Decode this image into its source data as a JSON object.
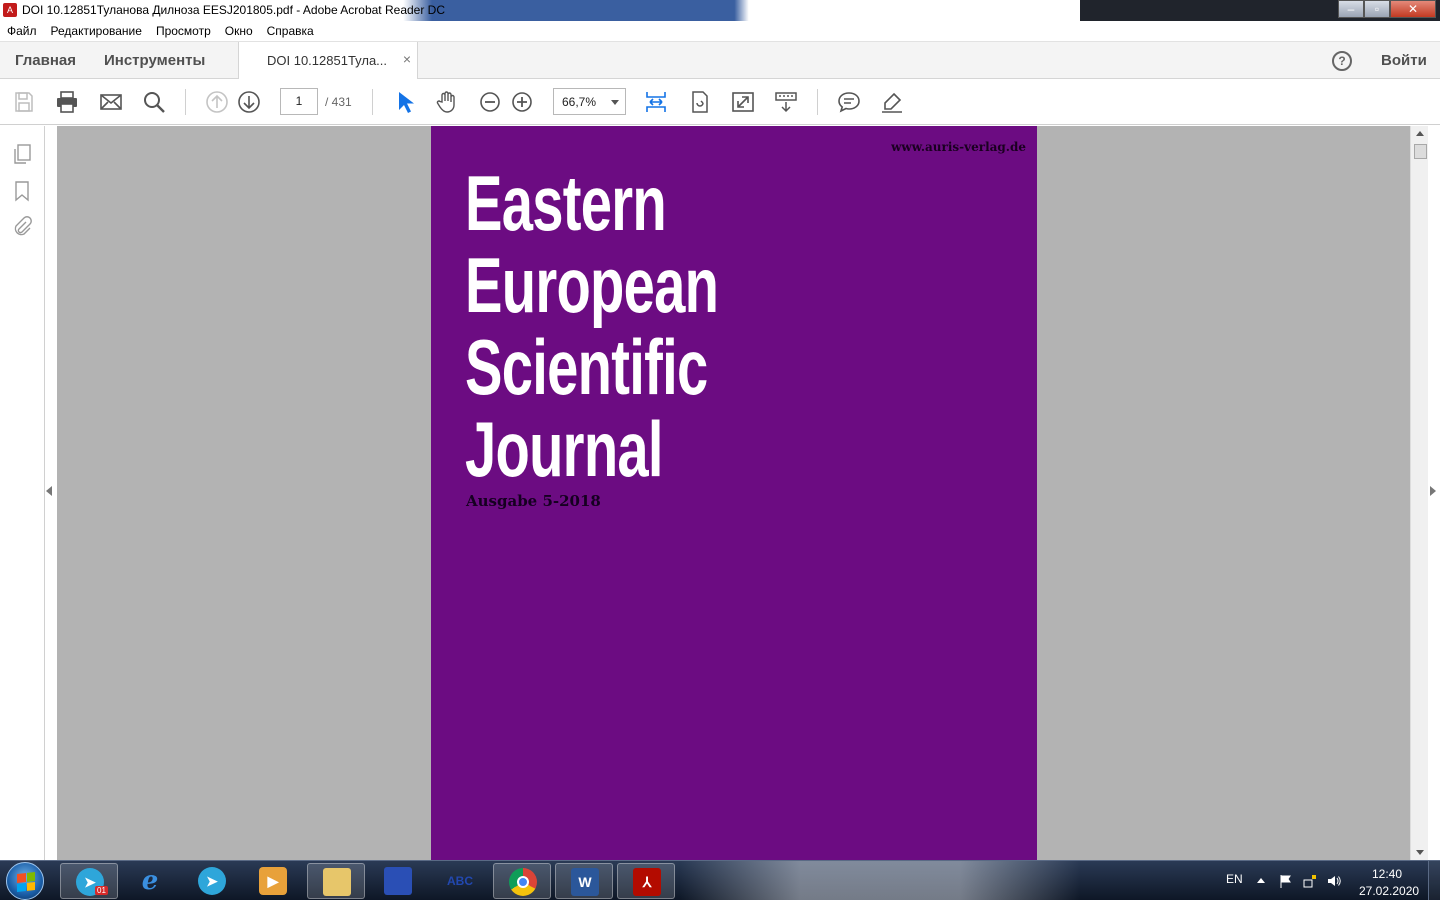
{
  "window": {
    "title": "DOI 10.12851Туланова Дилноза EESJ201805.pdf - Adobe Acrobat Reader DC"
  },
  "menu": {
    "items": [
      "Файл",
      "Редактирование",
      "Просмотр",
      "Окно",
      "Справка"
    ]
  },
  "tabs": {
    "home": "Главная",
    "tools": "Инструменты",
    "document": "DOI 10.12851Тула...",
    "close": "×",
    "help": "?",
    "signin": "Войти"
  },
  "toolbar": {
    "page_current": "1",
    "page_total": "/ 431",
    "zoom": "66,7%",
    "accent_color": "#1473e6"
  },
  "document": {
    "url": "www.auris-verlag.de",
    "title_lines": [
      "Eastern",
      "European",
      "Scientific",
      "Journal"
    ],
    "issue": "Ausgabe 5-2018",
    "cover_color": "#6c0c82"
  },
  "taskbar": {
    "apps": [
      {
        "name": "telegram-badge",
        "label": "01"
      },
      {
        "name": "internet-explorer",
        "label": "e"
      },
      {
        "name": "telegram",
        "label": ""
      },
      {
        "name": "media-player",
        "label": ""
      },
      {
        "name": "file-explorer",
        "label": ""
      },
      {
        "name": "floppy-app",
        "label": ""
      },
      {
        "name": "abc-app",
        "label": "ABC"
      },
      {
        "name": "chrome",
        "label": ""
      },
      {
        "name": "word",
        "label": "W"
      },
      {
        "name": "acrobat",
        "label": ""
      }
    ],
    "language": "EN",
    "time": "12:40",
    "date": "27.02.2020"
  }
}
